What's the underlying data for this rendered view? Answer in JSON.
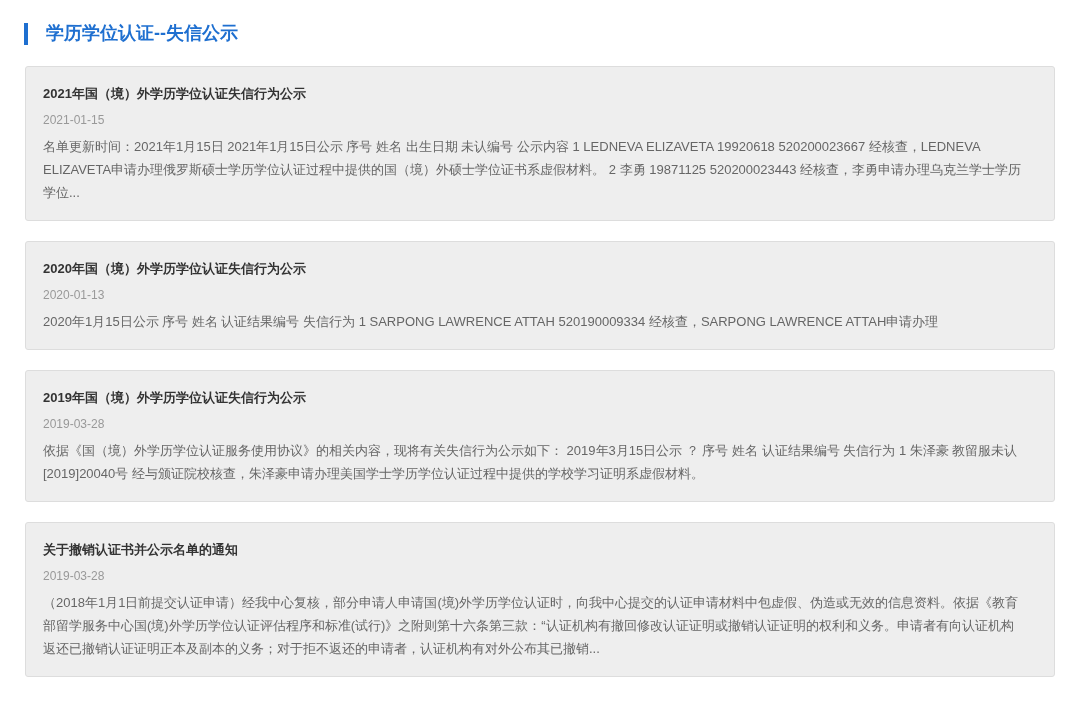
{
  "page_title": "学历学位认证--失信公示",
  "notices": [
    {
      "title": "2021年国（境）外学历学位认证失信行为公示",
      "date": "2021-01-15",
      "summary": "名单更新时间：2021年1月15日 2021年1月15日公示 序号 姓名 出生日期 未认编号 公示内容 1 LEDNEVA ELIZAVETA 19920618 520200023667 经核查，LEDNEVA ELIZAVETA申请办理俄罗斯硕士学历学位认证过程中提供的国（境）外硕士学位证书系虚假材料。 2 李勇 19871125 520200023443 经核查，李勇申请办理乌克兰学士学历学位..."
    },
    {
      "title": "2020年国（境）外学历学位认证失信行为公示",
      "date": "2020-01-13",
      "summary": "2020年1月15日公示 序号 姓名 认证结果编号 失信行为 1 SARPONG LAWRENCE ATTAH 520190009334 经核查，SARPONG LAWRENCE ATTAH申请办理"
    },
    {
      "title": "2019年国（境）外学历学位认证失信行为公示",
      "date": "2019-03-28",
      "summary": "依据《国（境）外学历学位认证服务使用协议》的相关内容，现将有关失信行为公示如下： 2019年3月15日公示 ？ 序号 姓名 认证结果编号 失信行为 1 朱泽豪 教留服未认[2019]20040号 经与颁证院校核查，朱泽豪申请办理美国学士学历学位认证过程中提供的学校学习证明系虚假材料。"
    },
    {
      "title": "关于撤销认证书并公示名单的通知",
      "date": "2019-03-28",
      "summary": "（2018年1月1日前提交认证申请）经我中心复核，部分申请人申请国(境)外学历学位认证时，向我中心提交的认证申请材料中包虚假、伪造或无效的信息资料。依据《教育部留学服务中心国(境)外学历学位认证评估程序和标准(试行)》之附则第十六条第三款：“认证机构有撤回修改认证证明或撤销认证证明的权利和义务。申请者有向认证机构返还已撤销认证证明正本及副本的义务；对于拒不返还的申请者，认证机构有对外公布其已撤销..."
    }
  ]
}
